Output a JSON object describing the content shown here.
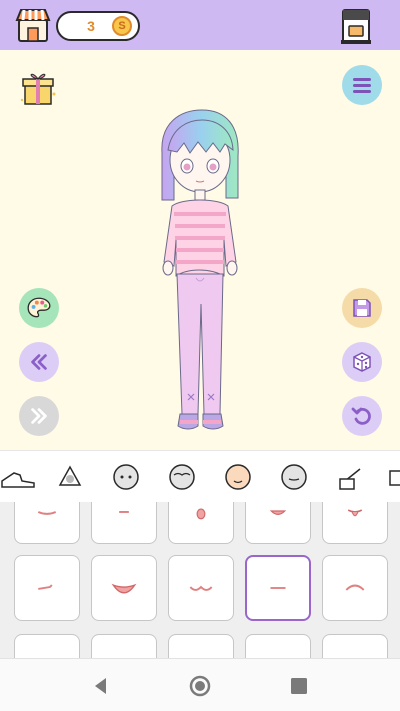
{
  "app": {
    "coins": "3",
    "coin_symbol": "S"
  },
  "colors": {
    "topbar": "#cfb9f2",
    "stage": "#fffbe7",
    "selected_border": "#9a66c9"
  },
  "toolbar_icons": [
    "shop-icon",
    "coin-icon",
    "coffee-machine-icon"
  ],
  "stage_buttons": {
    "left": [
      "palette-icon",
      "rewind-icon",
      "forward-icon"
    ],
    "right": [
      "menu-icon",
      "save-icon",
      "dice-icon",
      "undo-icon"
    ],
    "gift": "gift-icon"
  },
  "categories": [
    "shoes",
    "hair-back",
    "face-full",
    "face-bangs",
    "face-skin",
    "face-mouth",
    "accessory",
    "extra"
  ],
  "mouth_options": {
    "rows": 3,
    "selected_row": 1,
    "selected_col": 3
  },
  "navigation": [
    "back-icon",
    "home-icon",
    "recents-icon"
  ]
}
